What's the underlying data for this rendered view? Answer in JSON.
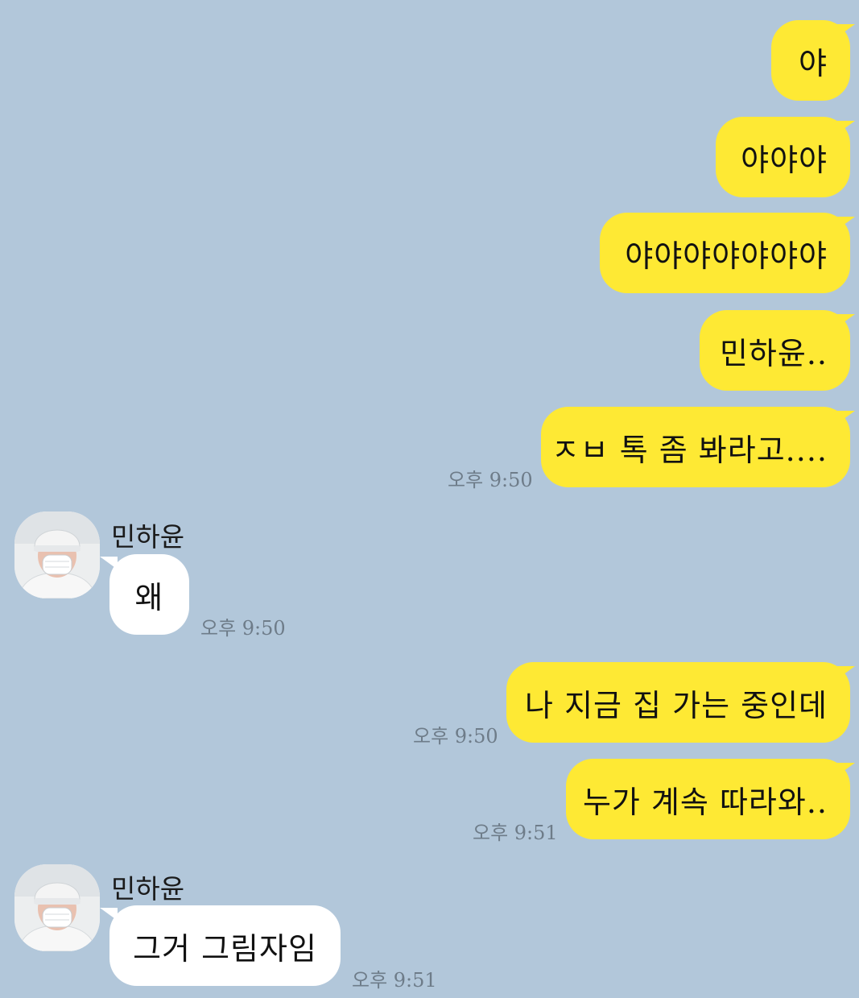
{
  "chat": {
    "contact_name": "민하윤",
    "messages": [
      {
        "from": "me",
        "text": "야"
      },
      {
        "from": "me",
        "text": "야야야"
      },
      {
        "from": "me",
        "text": "야야야야야야야"
      },
      {
        "from": "me",
        "text": "민하윤.."
      },
      {
        "from": "me",
        "text": "ㅈㅂ 톡 좀 봐라고....",
        "time": "오후 9:50"
      },
      {
        "from": "them",
        "sender": "민하윤",
        "text": "왜",
        "time": "오후 9:50"
      },
      {
        "from": "me",
        "text": "나 지금 집 가는 중인데",
        "time": "오후 9:50"
      },
      {
        "from": "me",
        "text": "누가 계속 따라와..",
        "time": "오후 9:51"
      },
      {
        "from": "them",
        "sender": "민하윤",
        "text": "그거 그림자임",
        "time": "오후 9:51"
      }
    ]
  },
  "icons": {
    "avatar": "profile-photo-icon"
  },
  "colors": {
    "background": "#b2c7da",
    "my_bubble": "#fee934",
    "their_bubble": "#ffffff",
    "timestamp": "#6e7c89"
  }
}
